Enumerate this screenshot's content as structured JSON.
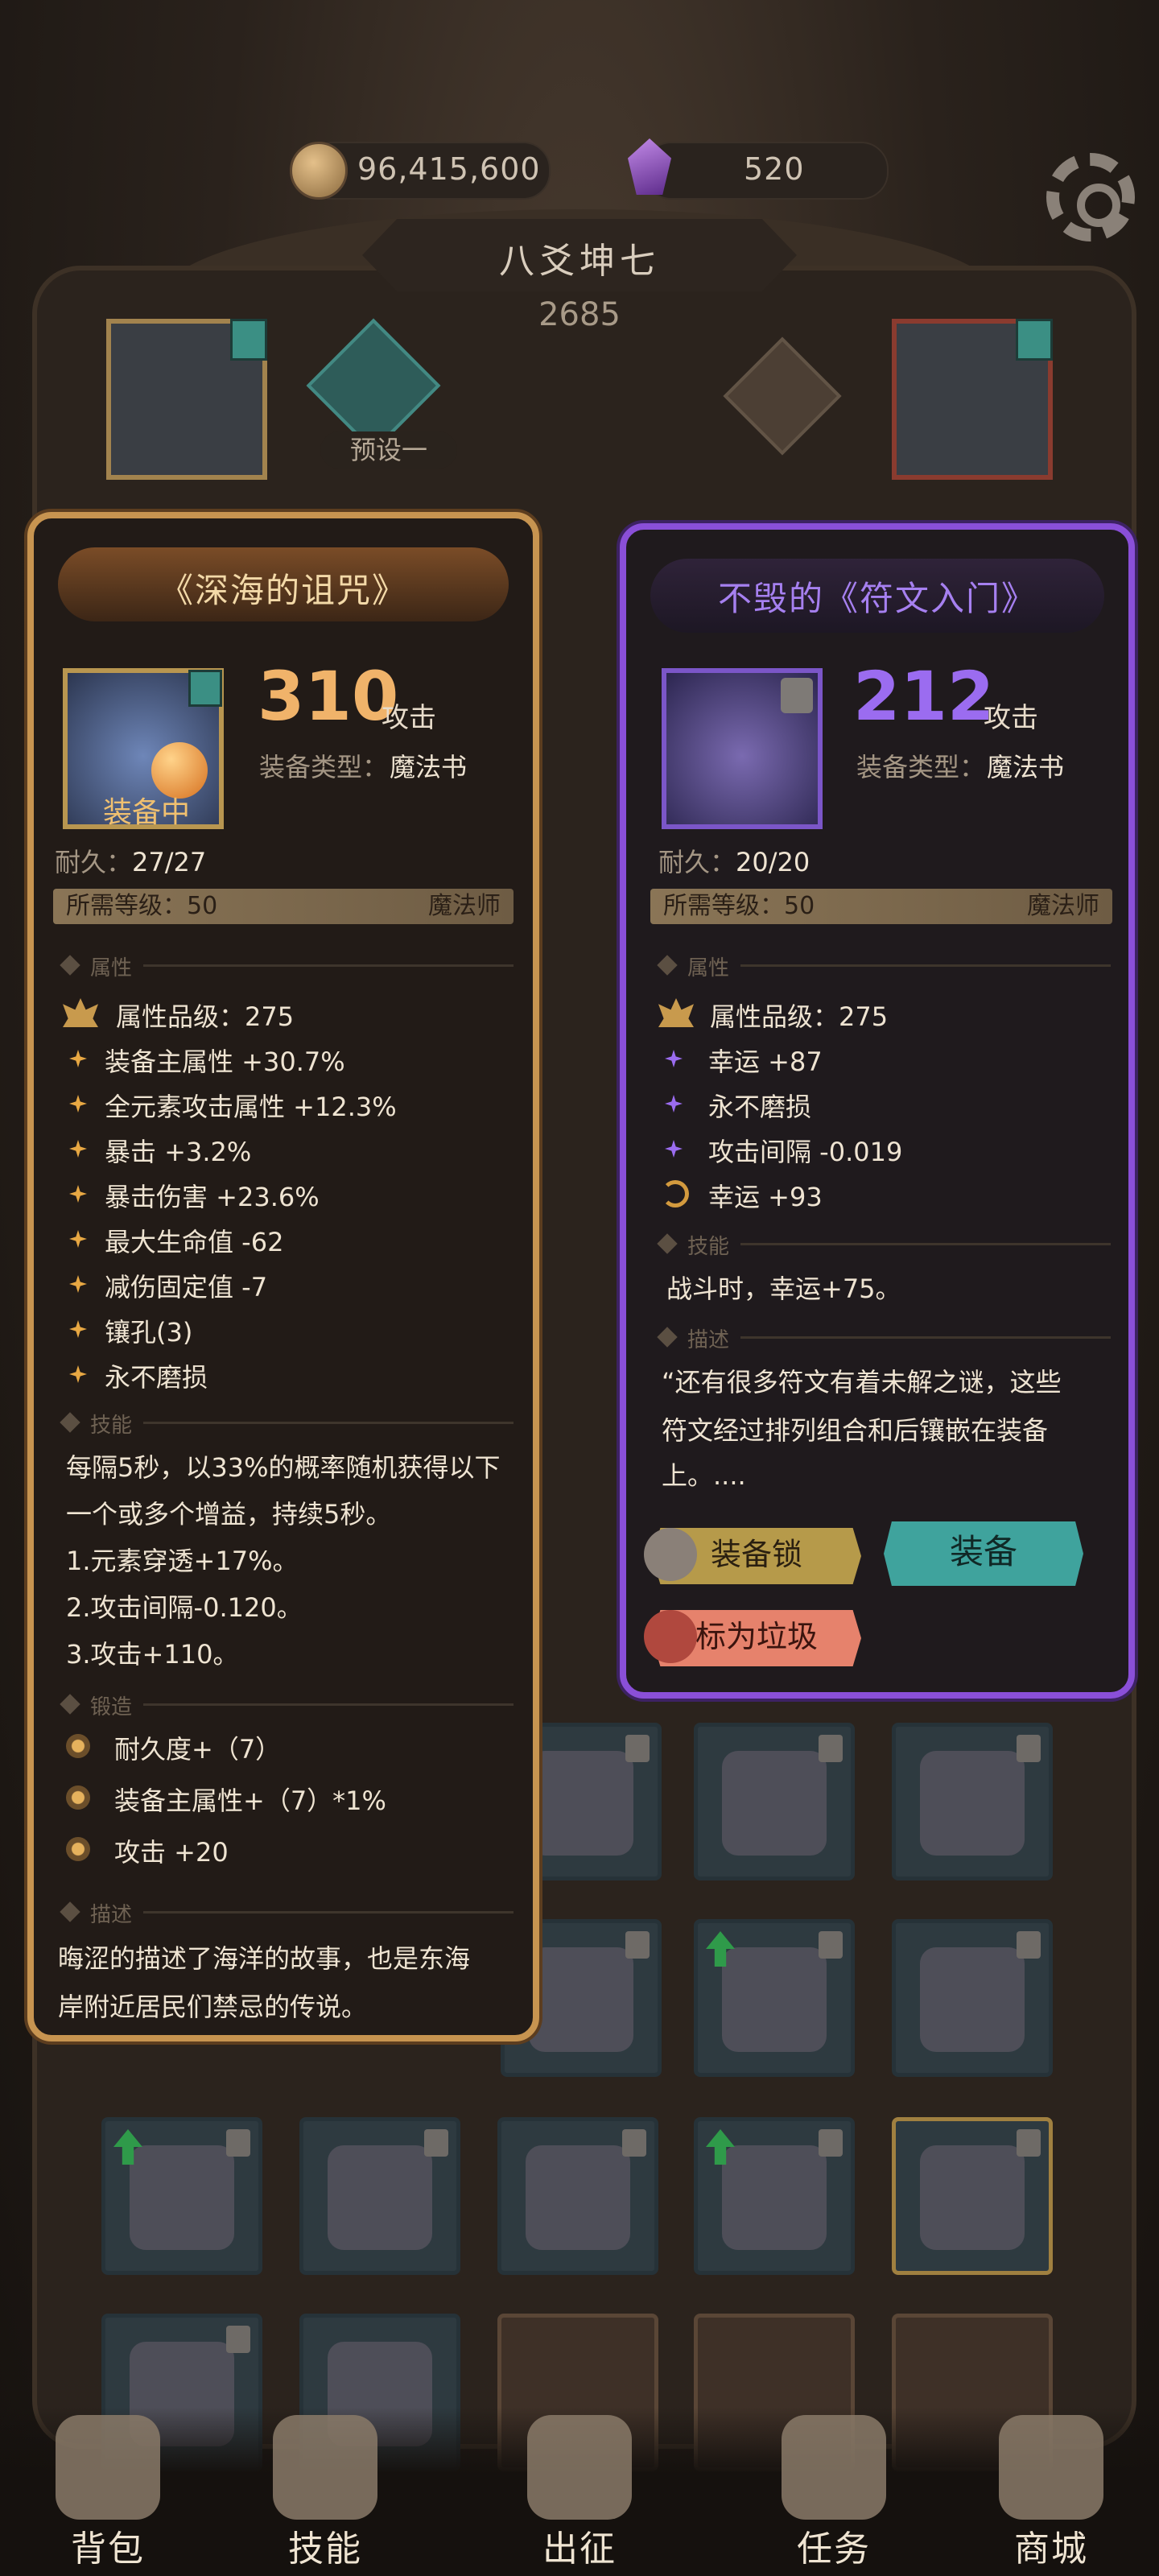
{
  "currency": {
    "gold": "96,415,600",
    "gems": "520"
  },
  "hero": {
    "name": "八爻坤七",
    "power": "2685",
    "preset_label": "预设一"
  },
  "left_panel": {
    "title": "《深海的诅咒》",
    "attack_value": "310",
    "attack_label": "攻击",
    "type_label": "装备类型：",
    "type_value": "魔法书",
    "equipped_label": "装备中",
    "durability_label": "耐久：",
    "durability_value": "27/27",
    "req_level": "所需等级：50",
    "req_class": "魔法师",
    "section_attr": "属性",
    "attr_quality": "属性品级：275",
    "attrs": [
      "装备主属性 +30.7%",
      "全元素攻击属性 +12.3%",
      "暴击 +3.2%",
      "暴击伤害 +23.6%",
      "最大生命值 -62",
      "减伤固定值 -7",
      "镶孔(3)",
      "永不磨损"
    ],
    "section_skill": "技能",
    "skill_lines": [
      "每隔5秒，以33%的概率随机获得以下",
      "一个或多个增益，持续5秒。",
      "1.元素穿透+17%。",
      "2.攻击间隔-0.120。",
      "3.攻击+110。"
    ],
    "section_forge": "锻造",
    "forge": [
      "耐久度+（7）",
      "装备主属性+（7）*1%",
      "攻击 +20"
    ],
    "section_desc": "描述",
    "desc_lines": [
      "晦涩的描述了海洋的故事，也是东海",
      "岸附近居民们禁忌的传说。"
    ]
  },
  "right_panel": {
    "title": "不毁的《符文入门》",
    "attack_value": "212",
    "attack_label": "攻击",
    "type_label": "装备类型：",
    "type_value": "魔法书",
    "durability_label": "耐久：",
    "durability_value": "20/20",
    "req_level": "所需等级：50",
    "req_class": "魔法师",
    "section_attr": "属性",
    "attr_quality": "属性品级：275",
    "attrs": [
      "幸运 +87",
      "永不磨损",
      "攻击间隔 -0.019",
      "幸运 +93"
    ],
    "section_skill": "技能",
    "skill_text": "战斗时，幸运+75。",
    "section_desc": "描述",
    "desc_lines": [
      "“还有很多符文有着未解之谜，这些",
      "符文经过排列组合和后镶嵌在装备",
      "上。...."
    ],
    "btn_lock": "装备锁",
    "btn_equip": "装备",
    "btn_trash": "标为垃圾"
  },
  "nav": [
    "背包",
    "技能",
    "出征",
    "任务",
    "商城"
  ],
  "colors": {
    "gold_accent": "#c79450",
    "purple_accent": "#8a4fd8",
    "left_attack": "#f0b36a",
    "right_attack": "#9b6cf0",
    "equip_button": "#3fa39d",
    "trash_button": "#e6826c",
    "lock_button": "#b69a4a"
  }
}
